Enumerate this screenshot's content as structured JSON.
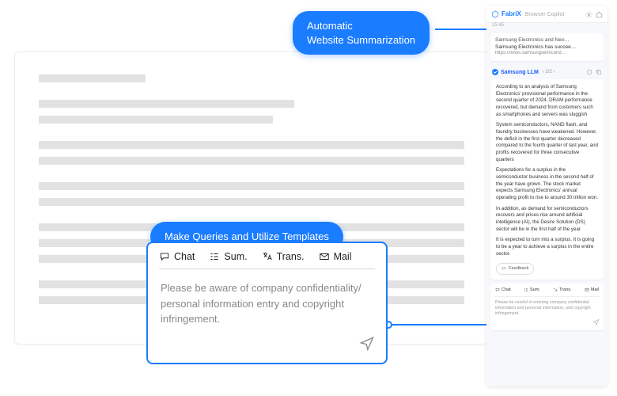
{
  "callouts": {
    "auto_l1": "Automatic",
    "auto_l2": "Website Summarization",
    "query": "Make Queries and Utilize Templates"
  },
  "query_panel": {
    "tabs": {
      "chat": "Chat",
      "sum": "Sum.",
      "trans": "Trans.",
      "mail": "Mail"
    },
    "prompt": "Please be aware of company confidentiality/ personal information entry and copyright infringement."
  },
  "copilot": {
    "brand": "FabriX",
    "brand_sub": "Browser Copilot",
    "time": "15:45",
    "card": {
      "line1": "Samsung Electronics and Neo…",
      "line2": "Samsung Electronics has succee…",
      "url": "https://news.samsungsemicond…"
    },
    "llm_label": "Samsung LLM",
    "nav": "‹ 2/2 ›",
    "answer": {
      "p1": "According to an analysis of Samsung Electronics' provisional performance in the second quarter of 2024, DRAM performance recovered, but demand from customers such as smartphones and servers was sluggish",
      "p2": "System semiconductors, NAND flash, and foundry businesses have weakened. However, the deficit in the first quarter decreased compared to the fourth quarter of last year, and profits recovered for three consecutive quarters",
      "p3": "Expectations for a surplus in the semiconductor business in the second half of the year have grown. The stock market expects Samsung Electronics' annual operating profit to rise to around 30 trillion won.",
      "p4": "In addition, as demand for semiconductors recovers and prices rise around artificial intelligence (AI), the Desire Solution (DS) sector will be in the first half of the year",
      "p5": "It is expected to turn into a surplus. It is going to be a year to achieve a surplus in the entire sector."
    },
    "feedback": "Feedback",
    "bottom": {
      "tabs": {
        "chat": "Chat",
        "sum": "Sum.",
        "trans": "Trans.",
        "mail": "Mail"
      },
      "prompt": "Please be careful of entering company confidential information and personal information, and copyright infringement."
    }
  }
}
